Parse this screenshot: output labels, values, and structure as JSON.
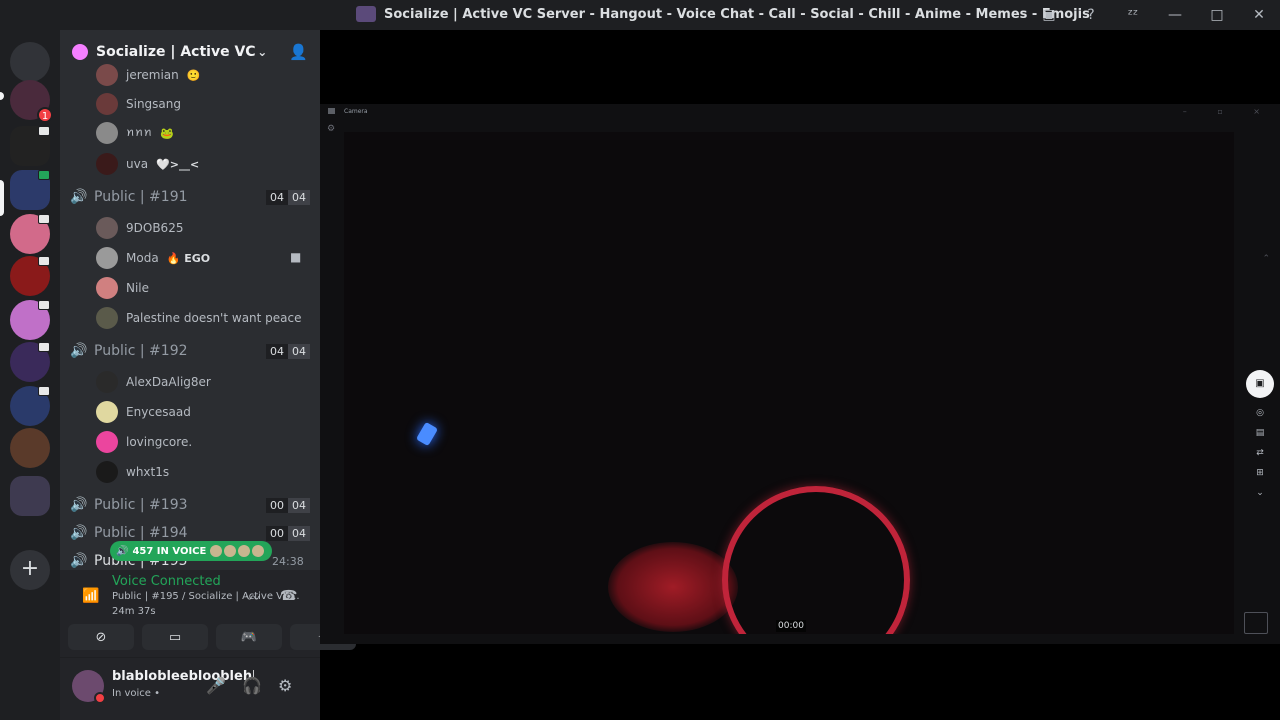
{
  "window": {
    "title": "Socialize | Active VC Server - Hangout - Voice Chat - Call - Social - Chill - Anime - Memes - Emojis",
    "controls": [
      "inbox-icon",
      "help-icon",
      "sleep-icon",
      "minimize",
      "maximize",
      "close"
    ]
  },
  "guilds": {
    "notification_count": "1",
    "add_label": "+"
  },
  "server": {
    "name": "Socialize | Active VC S...",
    "chevron": "⌄",
    "invite_icon": "add-member-icon"
  },
  "members_top": [
    {
      "name": "jeremian",
      "extra": "🙂"
    },
    {
      "name": "Singsang",
      "extra": ""
    },
    {
      "name": "ꪀꪀꪀ",
      "extra": "🐸"
    },
    {
      "name": "uva",
      "extra": "🤍>__<"
    }
  ],
  "channel_191": {
    "name": "Public | #191",
    "count_a": "04",
    "count_b": "04"
  },
  "members_191": [
    {
      "name": "9DOB625",
      "extra": ""
    },
    {
      "name": "Moda",
      "extra": "🔥 EGO"
    },
    {
      "name": "Nile",
      "extra": ""
    },
    {
      "name": "Palestine doesn't want peace",
      "extra": ""
    }
  ],
  "channel_192": {
    "name": "Public | #192",
    "count_a": "04",
    "count_b": "04"
  },
  "members_192": [
    {
      "name": "AlexDaAlig8er",
      "extra": ""
    },
    {
      "name": "Enycesaad",
      "extra": ""
    },
    {
      "name": "lovingcore.",
      "extra": ""
    },
    {
      "name": "whxt1s",
      "extra": ""
    }
  ],
  "channel_193": {
    "name": "Public | #193",
    "count_a": "00",
    "count_b": "04"
  },
  "channel_194": {
    "name": "Public | #194",
    "count_a": "00",
    "count_b": "04"
  },
  "channel_195": {
    "name": "Public | #195"
  },
  "in_voice_pill": "457 IN VOICE",
  "call_timer": "24:38",
  "voice": {
    "status": "Voice Connected",
    "channel": "Public | #195 / Socialize | Active VC...",
    "elapsed": "24m 37s"
  },
  "user": {
    "name": "blablobleeblooblehh...",
    "status": "In voice •"
  },
  "stage": {
    "label": "Camera",
    "video_time": "00:00"
  },
  "colors": {
    "voice_green": "#23a559",
    "sidebar_bg": "#2b2d31",
    "guild_bg": "#1e1f22",
    "accent_red": "#f23f43"
  }
}
